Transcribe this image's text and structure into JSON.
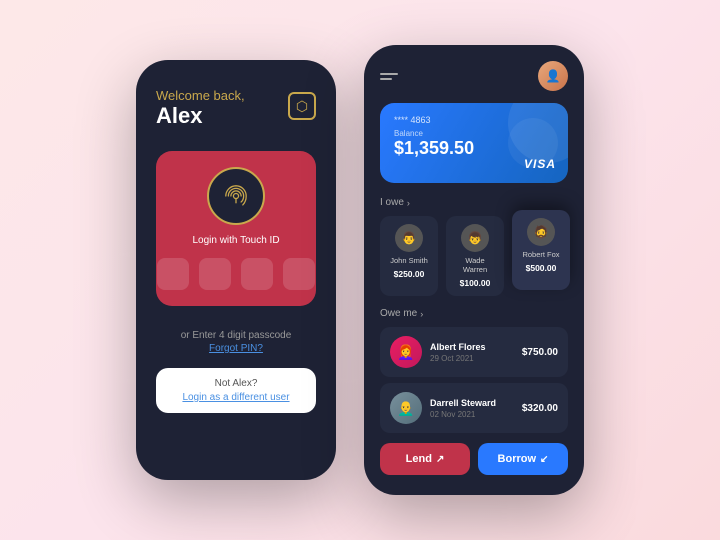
{
  "left_phone": {
    "welcome": "Welcome back,",
    "name": "Alex",
    "cube_icon": "⬡",
    "touch_id_label": "Login with Touch ID",
    "or_enter": "or Enter 4 digit passcode",
    "forgot_pin": "Forgot PIN?",
    "not_alex": "Not Alex?",
    "login_diff": "Login as a different user"
  },
  "right_phone": {
    "card": {
      "number": "**** 4863",
      "balance_label": "Balance",
      "balance": "$1,359.50",
      "brand": "VISA"
    },
    "i_owe_label": "I owe",
    "owe_me_label": "Owe me",
    "i_owe": [
      {
        "name": "John Smith",
        "amount": "$250.00",
        "emoji": "👨"
      },
      {
        "name": "Wade Warren",
        "amount": "$100.00",
        "emoji": "👨‍🦱"
      },
      {
        "name": "Robert Fox",
        "amount": "$500.00",
        "emoji": "🧔",
        "raised": true
      }
    ],
    "owe_me": [
      {
        "name": "Albert Flores",
        "date": "29 Oct 2021",
        "amount": "$750.00",
        "emoji": "👩‍🦰"
      },
      {
        "name": "Darrell Steward",
        "date": "02 Nov 2021",
        "amount": "$320.00",
        "emoji": "👨‍🦲"
      }
    ],
    "lend_label": "Lend",
    "borrow_label": "Borrow",
    "lend_arrow": "↗",
    "borrow_arrow": "↙"
  }
}
